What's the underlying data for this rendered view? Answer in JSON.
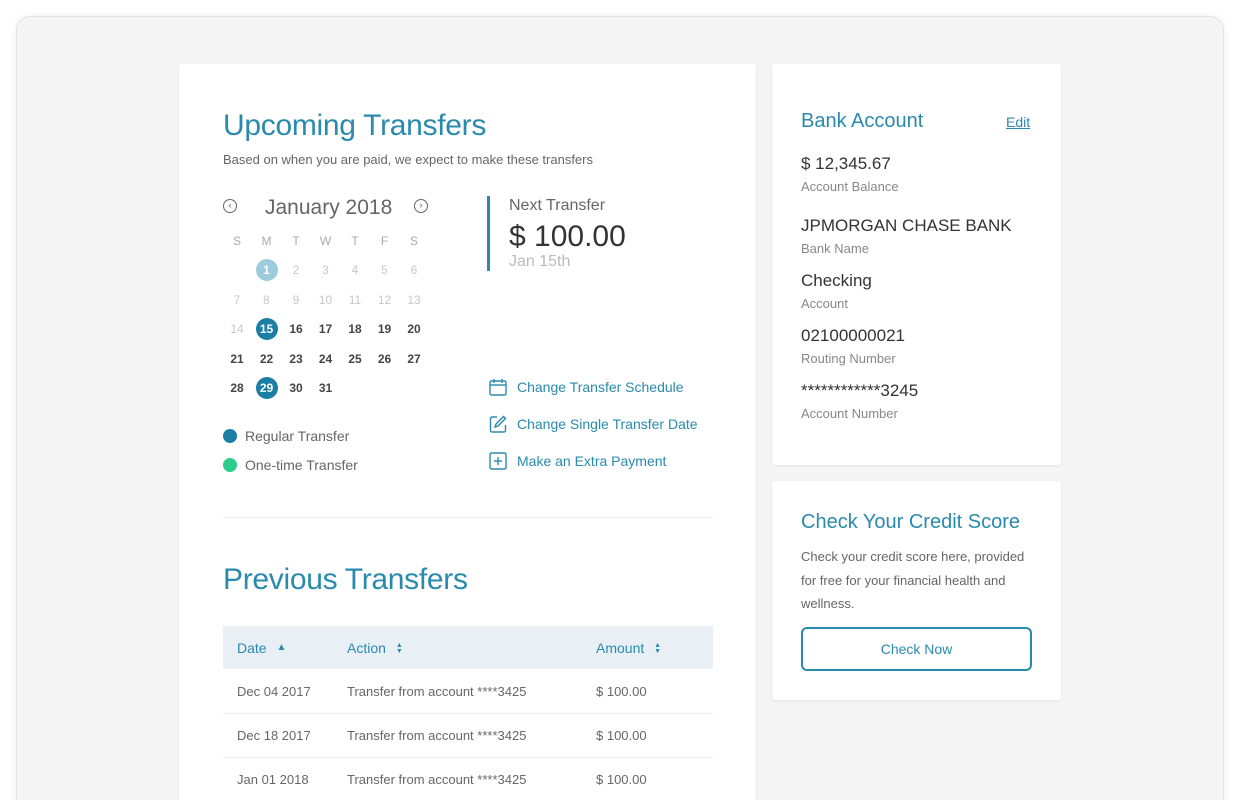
{
  "upcoming": {
    "title": "Upcoming Transfers",
    "subtitle": "Based on when you are paid, we expect to make these transfers",
    "calendar": {
      "month": "January 2018",
      "prev_icon": "arrow-left-circle-icon",
      "next_icon": "arrow-right-circle-icon",
      "weekdays": [
        "S",
        "M",
        "T",
        "W",
        "T",
        "F",
        "S"
      ],
      "weeks": [
        [
          "",
          "1",
          "2",
          "3",
          "4",
          "5",
          "6"
        ],
        [
          "7",
          "8",
          "9",
          "10",
          "11",
          "12",
          "13"
        ],
        [
          "14",
          "15",
          "16",
          "17",
          "18",
          "19",
          "20"
        ],
        [
          "21",
          "22",
          "23",
          "24",
          "25",
          "26",
          "27"
        ],
        [
          "28",
          "29",
          "30",
          "31",
          "",
          "",
          ""
        ]
      ],
      "past_days": [
        "1",
        "2",
        "3",
        "4",
        "5",
        "6",
        "7",
        "8",
        "9",
        "10",
        "11",
        "12",
        "13",
        "14"
      ],
      "regular_transfer_days": [
        "15",
        "29"
      ],
      "past_transfer_days": [
        "1"
      ]
    },
    "legend": [
      {
        "label": "Regular Transfer",
        "color": "#1a7fa3"
      },
      {
        "label": "One-time Transfer",
        "color": "#2ecc8e"
      }
    ],
    "next_transfer": {
      "label": "Next Transfer",
      "amount": "$ 100.00",
      "date": "Jan 15th"
    },
    "actions": [
      {
        "label": "Change Transfer Schedule",
        "icon": "calendar-icon"
      },
      {
        "label": "Change Single Transfer Date",
        "icon": "edit-icon"
      },
      {
        "label": "Make an Extra Payment",
        "icon": "plus-square-icon"
      }
    ]
  },
  "previous": {
    "title": "Previous Transfers",
    "columns": [
      {
        "label": "Date",
        "sort_icon": "sort-asc-icon"
      },
      {
        "label": "Action",
        "sort_icon": "sort-icon"
      },
      {
        "label": "Amount",
        "sort_icon": "sort-icon"
      }
    ],
    "rows": [
      {
        "date": "Dec 04 2017",
        "action": "Transfer from account ****3425",
        "amount": "$ 100.00"
      },
      {
        "date": "Dec 18 2017",
        "action": "Transfer from account ****3425",
        "amount": "$ 100.00"
      },
      {
        "date": "Jan 01 2018",
        "action": "Transfer from account ****3425",
        "amount": "$ 100.00"
      }
    ]
  },
  "bank": {
    "title": "Bank Account",
    "edit_label": "Edit",
    "fields": [
      {
        "value": "$ 12,345.67",
        "label": "Account Balance"
      },
      {
        "value": "JPMORGAN CHASE BANK",
        "label": "Bank Name"
      },
      {
        "value": "Checking",
        "label": "Account"
      },
      {
        "value": "02100000021",
        "label": "Routing Number"
      },
      {
        "value": "************3245",
        "label": "Account Number"
      }
    ]
  },
  "credit": {
    "title": "Check Your Credit Score",
    "text": "Check your credit score here, provided for free for your financial health and wellness.",
    "button_label": "Check Now"
  },
  "colors": {
    "accent": "#2a8aad",
    "regular": "#1a7fa3",
    "onetime": "#2ecc8e",
    "table_header": "#e8eff5"
  }
}
